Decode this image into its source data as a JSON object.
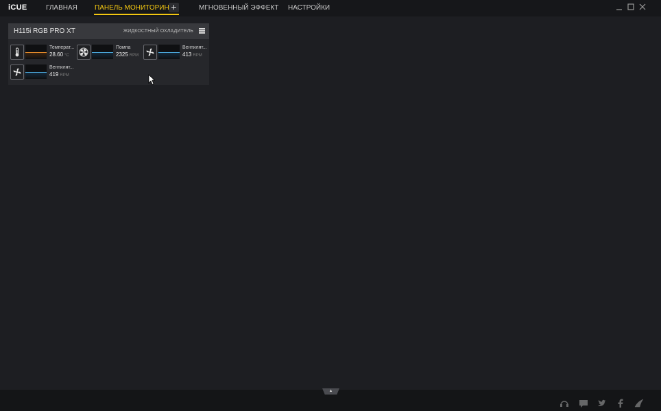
{
  "app": {
    "logo": "iCUE"
  },
  "nav": {
    "tabs": [
      {
        "label": "ГЛАВНАЯ",
        "active": false
      },
      {
        "label": "ПАНЕЛЬ МОНИТОРИНГА",
        "active": true
      },
      {
        "label": "МГНОВЕННЫЙ ЭФФЕКТ",
        "active": false
      },
      {
        "label": "НАСТРОЙКИ",
        "active": false
      }
    ],
    "add_label": "+"
  },
  "window_controls": {
    "minimize": "—",
    "maximize": "☐",
    "close": "✕"
  },
  "widget": {
    "title": "H115i RGB PRO XT",
    "type": "ЖИДКОСТНЫЙ ОХЛАДИТЕЛЬ",
    "sensors": [
      {
        "icon": "thermometer-icon",
        "label": "Температ...",
        "value": "28.60",
        "unit": "°C",
        "color": "#e0882a"
      },
      {
        "icon": "pump-icon",
        "label": "Помпа",
        "value": "2325",
        "unit": "RPM",
        "color": "#4aa6d8"
      },
      {
        "icon": "fan-icon",
        "label": "Вентилят...",
        "value": "413",
        "unit": "RPM",
        "color": "#4aa6d8"
      },
      {
        "icon": "fan-icon",
        "label": "Вентилят...",
        "value": "419",
        "unit": "RPM",
        "color": "#4aa6d8"
      }
    ]
  },
  "colors": {
    "accent": "#f3c711"
  },
  "bottom": {
    "expand_label": "▲"
  }
}
